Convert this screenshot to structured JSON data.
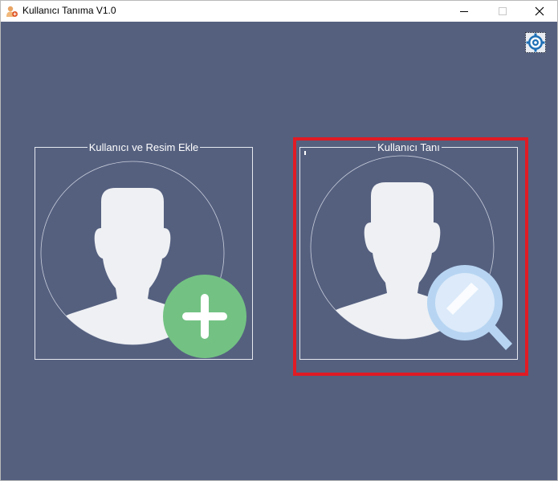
{
  "window": {
    "title": "Kullanıcı Tanıma V1.0",
    "icon": "person-add-icon"
  },
  "titlebar": {
    "minimize_icon": "minimize-icon",
    "maximize_icon": "maximize-icon",
    "close_icon": "close-icon"
  },
  "toolbar": {
    "settings_icon": "gear-icon"
  },
  "cards": {
    "add_user": {
      "label": "Kullanıcı ve Resim Ekle",
      "icon": "add-user-icon",
      "badge_icon": "plus-icon"
    },
    "recognize_user": {
      "label": "Kullanıcı Tanı",
      "icon": "search-user-icon",
      "badge_icon": "magnifier-icon"
    }
  },
  "colors": {
    "background": "#55607f",
    "highlight": "#e01b24",
    "plus_badge": "#73c283",
    "magnifier": "#b7d5f2",
    "avatar": "#eef0f3"
  }
}
